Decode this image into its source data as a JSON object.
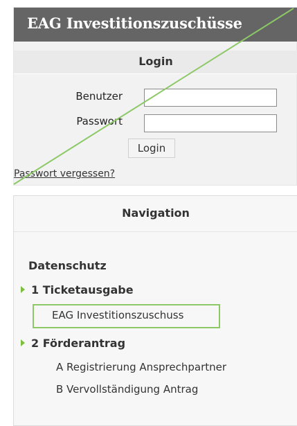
{
  "login_panel": {
    "header_title": "EAG Investitionszuschüsse",
    "section_title": "Login",
    "username_label": "Benutzer",
    "username_value": "",
    "password_label": "Passwort",
    "password_value": "",
    "login_button": "Login",
    "forgot_password_link": "Passwort vergessen?"
  },
  "navigation": {
    "title": "Navigation",
    "items": [
      {
        "label": "Datenschutz"
      },
      {
        "label": "1 Ticketausgabe",
        "children": [
          {
            "label": "EAG Investitionszuschuss",
            "highlighted": true
          }
        ]
      },
      {
        "label": "2 Förderantrag",
        "children": [
          {
            "label": "A Registrierung Ansprechpartner"
          },
          {
            "label": "B Vervollständigung Antrag"
          }
        ]
      }
    ]
  },
  "colors": {
    "header_background": "#656565",
    "accent_green": "#7cbf3c",
    "highlight_border": "#8cc866"
  }
}
